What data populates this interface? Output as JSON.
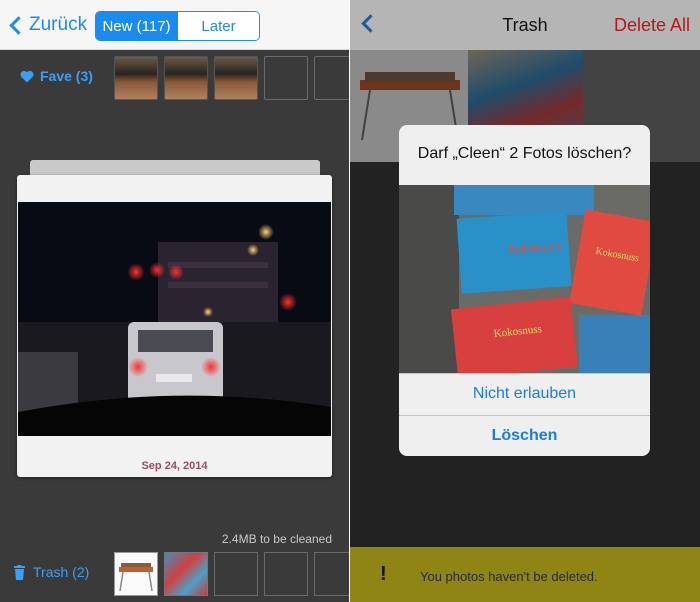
{
  "left_screen": {
    "nav": {
      "back_label": "Zurück",
      "segments": [
        "New (117)",
        "Later"
      ],
      "selected_segment": "New (117)"
    },
    "fave": {
      "label": "Fave (3)",
      "icon": "heart-icon",
      "photo_count": 3,
      "empty_slots": 2
    },
    "card": {
      "date": "Sep 24, 2014"
    },
    "cleaned_text": "2.4MB to be cleaned",
    "trash": {
      "label": "Trash (2)",
      "icon": "trash-icon",
      "photo_count": 2,
      "empty_slots": 3
    },
    "accent_color": "#1a8cf0"
  },
  "right_screen": {
    "nav": {
      "title": "Trash",
      "action_label": "Delete All",
      "action_color": "#b01a1a"
    },
    "alert": {
      "title": "Darf „Cleen“ 2 Fotos löschen?",
      "buttons": [
        "Nicht erlauben",
        "Löschen"
      ]
    },
    "toast": {
      "icon": "!",
      "text": "You photos haven't be deleted."
    }
  }
}
